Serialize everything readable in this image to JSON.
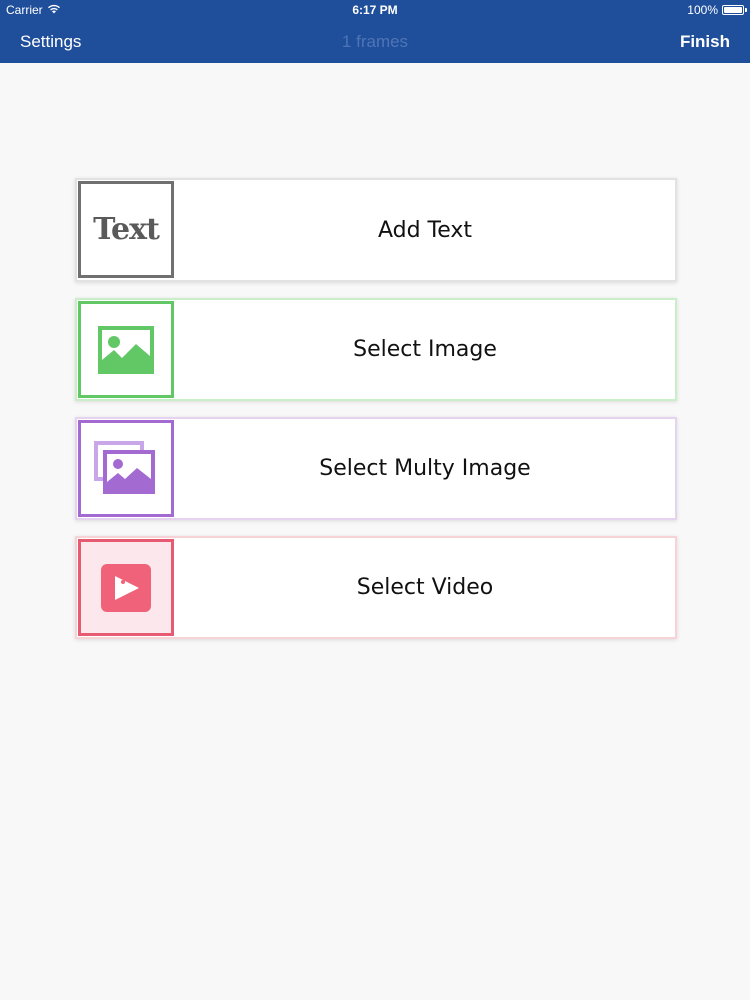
{
  "status_bar": {
    "carrier": "Carrier",
    "time": "6:17 PM",
    "battery": "100%",
    "battery_level": 1.0
  },
  "nav": {
    "left_label": "Settings",
    "title": "1 frames",
    "right_label": "Finish"
  },
  "options": [
    {
      "label": "Add Text",
      "icon": "text-icon",
      "icon_text": "Text",
      "accent": "#707070"
    },
    {
      "label": "Select Image",
      "icon": "image-icon",
      "accent": "#62c866"
    },
    {
      "label": "Select Multy Image",
      "icon": "multi-image-icon",
      "accent": "#a36ad2"
    },
    {
      "label": "Select Video",
      "icon": "video-icon",
      "accent": "#e65a72"
    }
  ],
  "colors": {
    "nav_background": "#1f4f9b",
    "page_background": "#f8f8f9"
  }
}
